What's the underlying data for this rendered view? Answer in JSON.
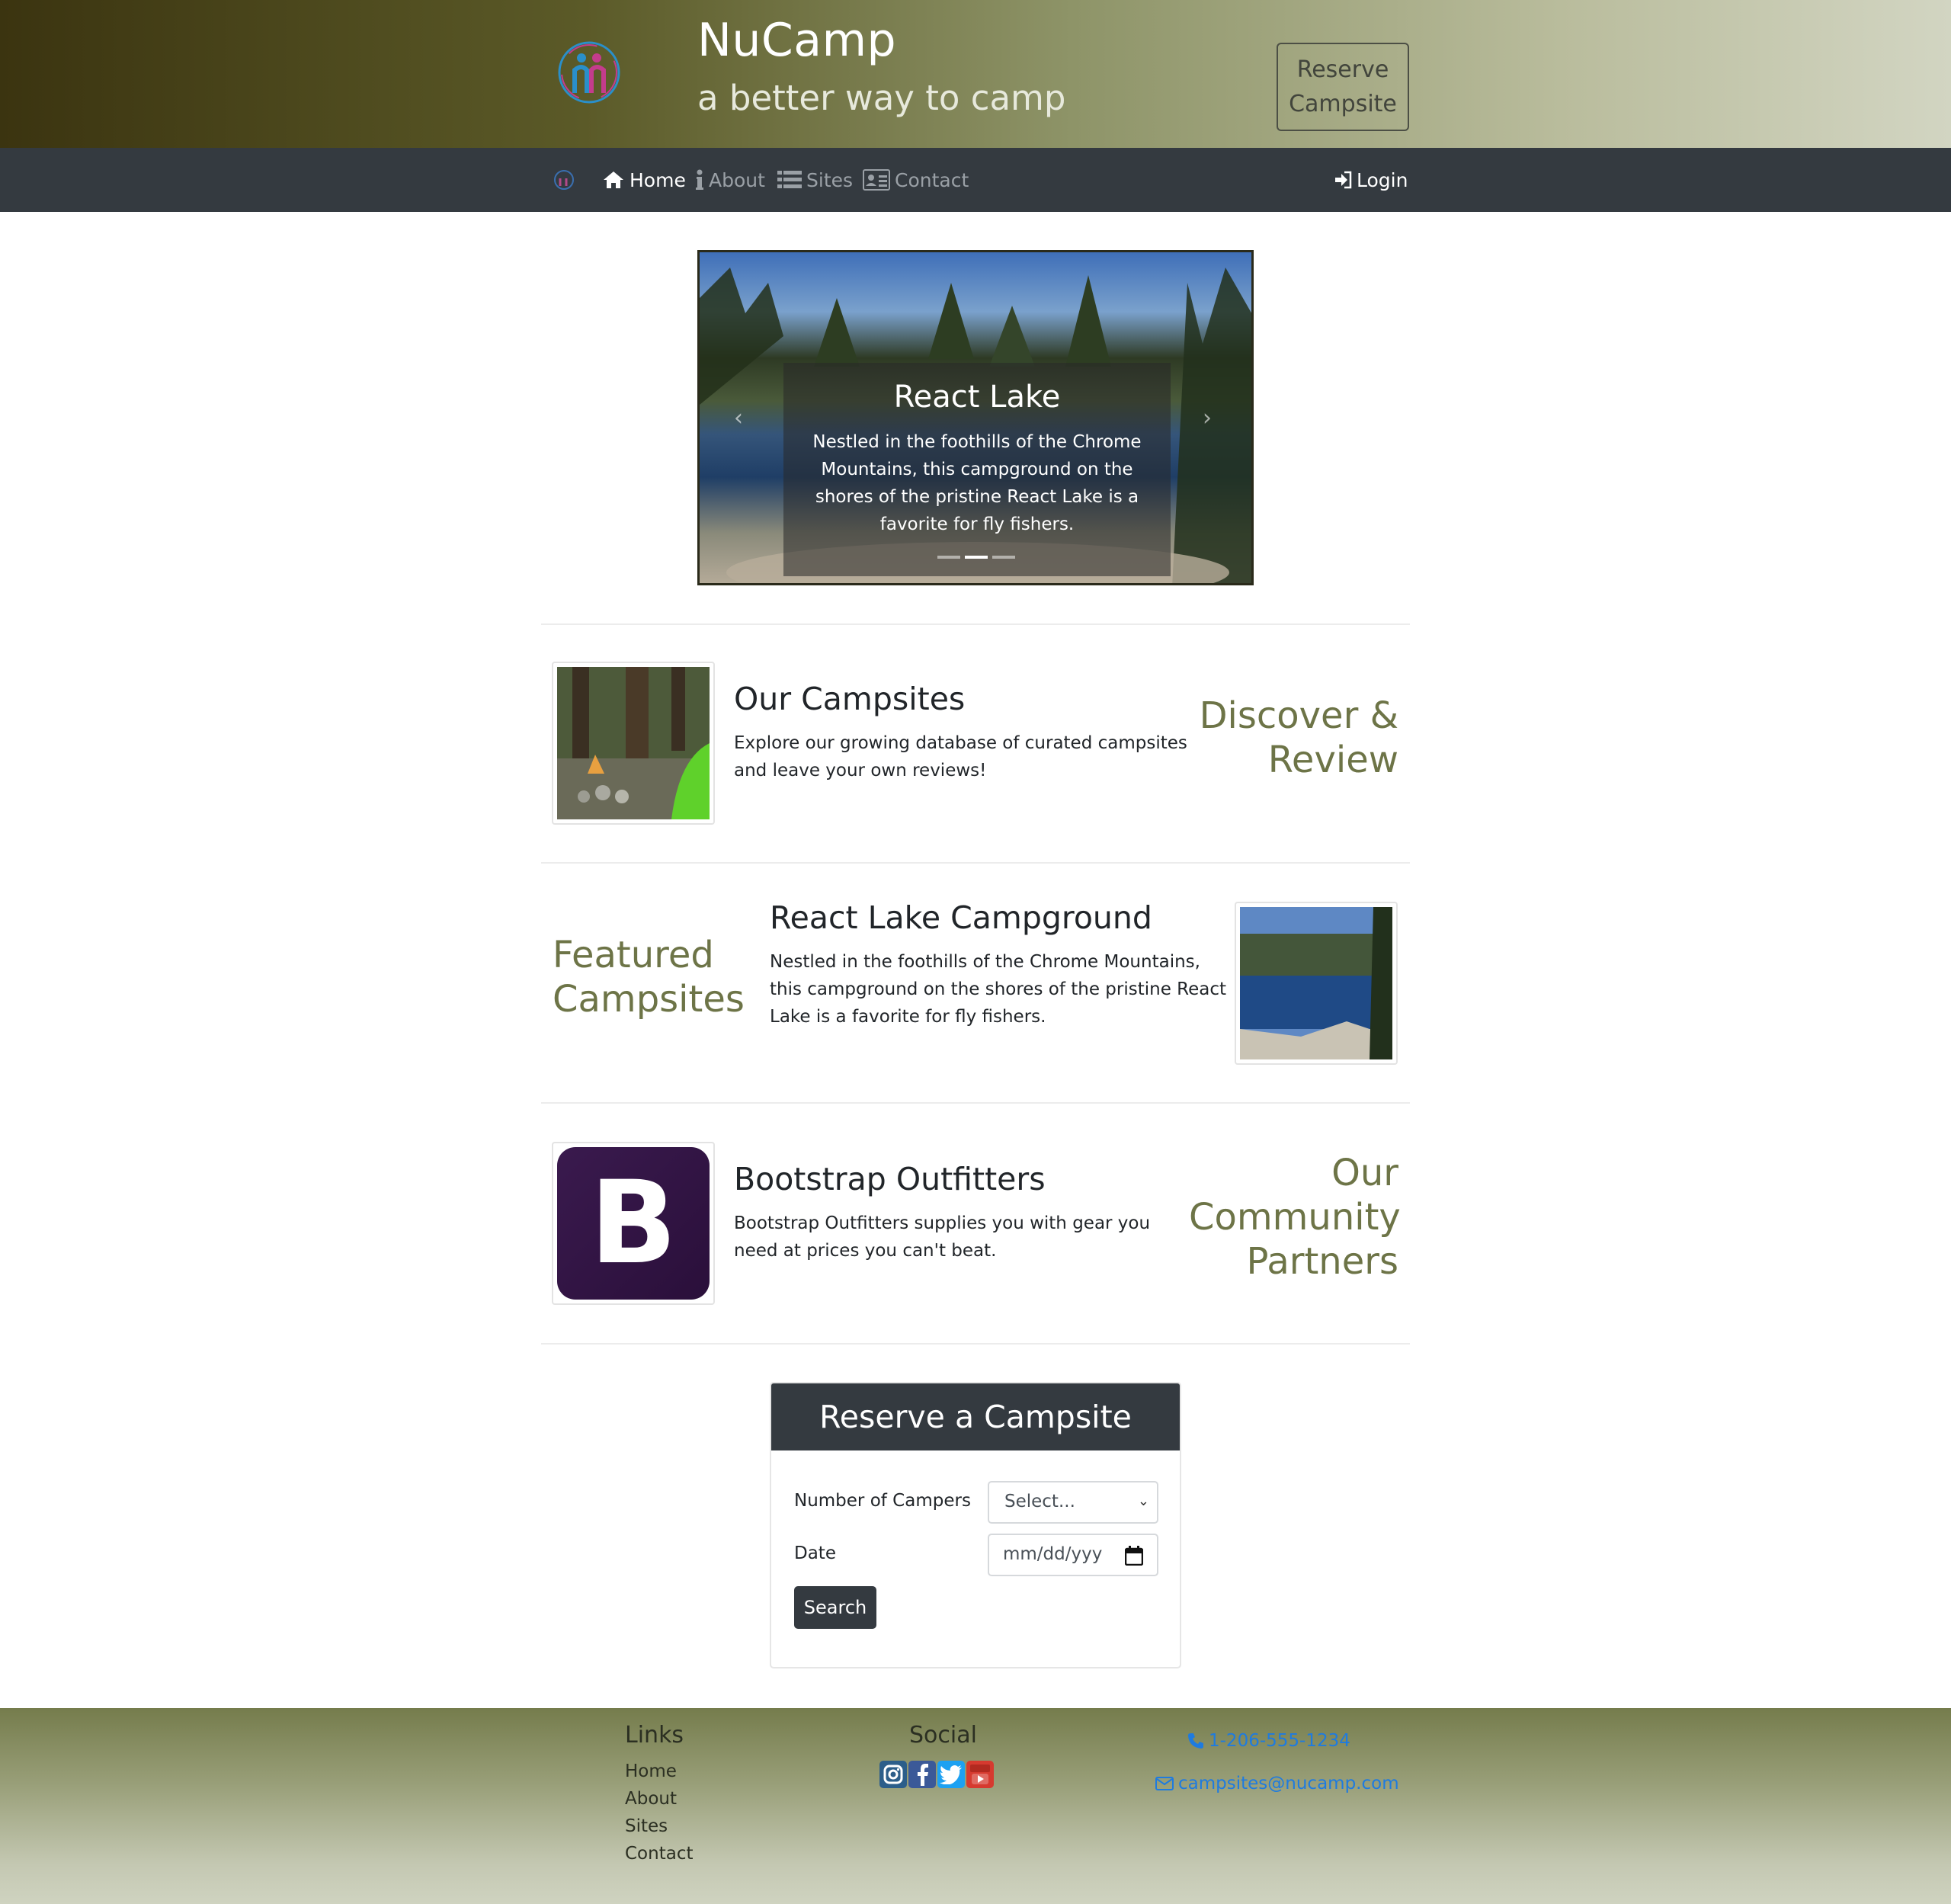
{
  "header": {
    "brand_title": "NuCamp",
    "brand_subtitle": "a better way to camp",
    "reserve_button": "Reserve Campsite"
  },
  "nav": {
    "items": [
      {
        "label": "Home",
        "icon": "home-icon",
        "active": true
      },
      {
        "label": "About",
        "icon": "info-icon",
        "active": false
      },
      {
        "label": "Sites",
        "icon": "list-icon",
        "active": false
      },
      {
        "label": "Contact",
        "icon": "address-card-icon",
        "active": false
      }
    ],
    "login": "Login"
  },
  "carousel": {
    "title": "React Lake",
    "text": "Nestled in the foothills of the Chrome Mountains, this campground on the shores of the pristine React Lake is a favorite for fly fishers.",
    "slides": 3,
    "active_slide": 2
  },
  "sections": {
    "campsites": {
      "title": "Our Campsites",
      "text": "Explore our growing database of curated campsites and leave your own reviews!",
      "side_heading": "Discover & Review"
    },
    "featured": {
      "title": "React Lake Campground",
      "text": "Nestled in the foothills of the Chrome Mountains, this campground on the shores of the pristine React Lake is a favorite for fly fishers.",
      "side_heading": "Featured Campsites"
    },
    "partners": {
      "title": "Bootstrap Outfitters",
      "text": "Bootstrap Outfitters supplies you with gear you need at prices you can't beat.",
      "side_heading": "Our Community Partners",
      "logo_letter": "B"
    }
  },
  "reserve_form": {
    "title": "Reserve a Campsite",
    "campers_label": "Number of Campers",
    "campers_value": "Select...",
    "date_label": "Date",
    "date_placeholder": "mm/dd/yyy",
    "search_button": "Search"
  },
  "footer": {
    "links_heading": "Links",
    "links": [
      "Home",
      "About",
      "Sites",
      "Contact"
    ],
    "social_heading": "Social",
    "social_icons": [
      "instagram-icon",
      "facebook-icon",
      "twitter-icon",
      "youtube-icon"
    ],
    "phone": "1-206-555-1234",
    "email": "campsites@nucamp.com"
  },
  "colors": {
    "accent_olive": "#6d7447",
    "navbar": "#343a40",
    "link_blue": "#1e7be0"
  }
}
